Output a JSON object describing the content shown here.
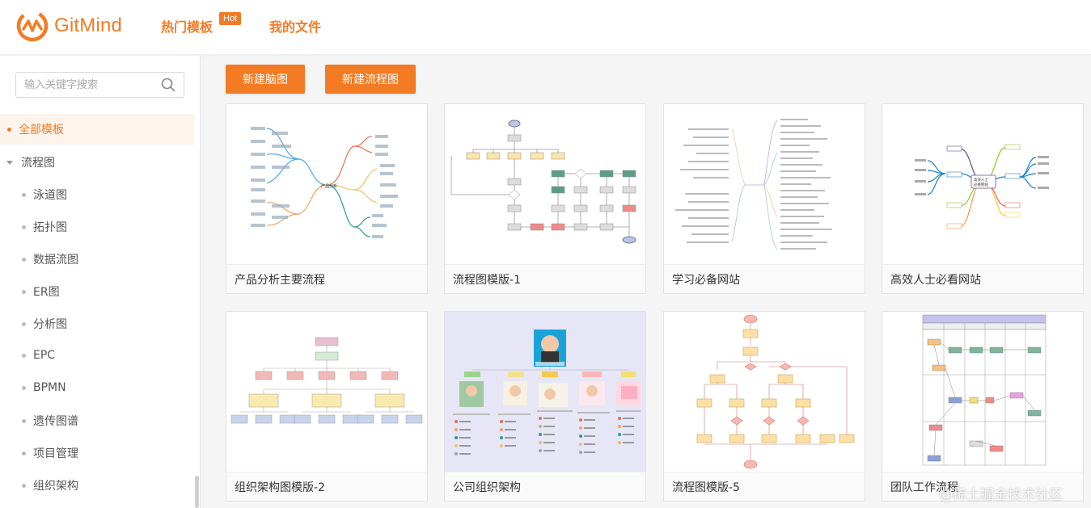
{
  "app": {
    "brand": "GitMind",
    "brand_color": "#f37b24",
    "nav": [
      {
        "label": "热门模板",
        "badge": "Hot"
      },
      {
        "label": "我的文件"
      }
    ]
  },
  "sidebar": {
    "search_placeholder": "输入关键字搜索",
    "all_label": "全部模板",
    "flow_label": "流程图",
    "items": [
      "泳道图",
      "拓扑图",
      "数据流图",
      "ER图",
      "分析图",
      "EPC",
      "BPMN",
      "遗传图谱",
      "项目管理",
      "组织架构"
    ]
  },
  "toolbar": {
    "new_mindmap": "新建脑图",
    "new_flowchart": "新建流程图"
  },
  "templates": [
    {
      "title": "产品分析主要流程",
      "icon": "mindmap-thumbnail"
    },
    {
      "title": "流程图模版-1",
      "icon": "flowchart-thumbnail"
    },
    {
      "title": "学习必备网站",
      "icon": "mindmap-list-thumbnail"
    },
    {
      "title": "高效人士必看网站",
      "icon": "mindmap-colorful-thumbnail"
    },
    {
      "title": "组织架构图模版-2",
      "icon": "org-chart-thumbnail"
    },
    {
      "title": "公司组织架构",
      "icon": "avatar-org-thumbnail"
    },
    {
      "title": "流程图模版-5",
      "icon": "flowchart-thumbnail"
    },
    {
      "title": "团队工作流程",
      "icon": "swimlane-thumbnail"
    }
  ],
  "thumb_text": {
    "mindmap_center": "产品分析",
    "colorful_center_1": "高效人士",
    "colorful_center_2": "必看网站"
  },
  "watermark": "@稀土掘金技术社区"
}
